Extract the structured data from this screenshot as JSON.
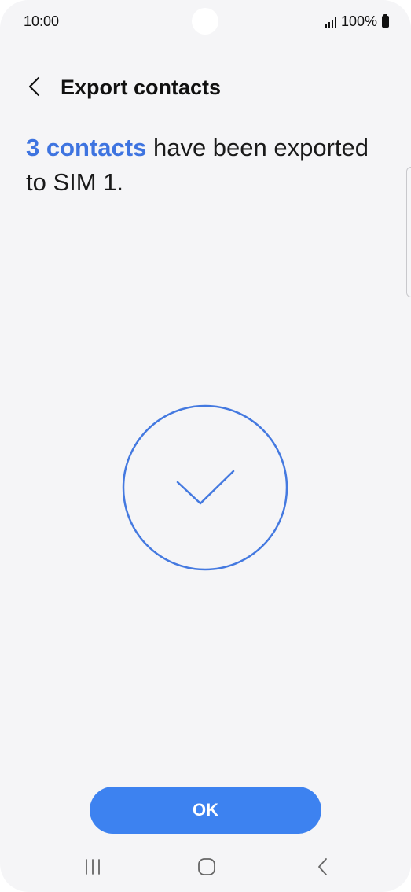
{
  "status_bar": {
    "time": "10:00",
    "battery_text": "100%",
    "icons": [
      "signal-icon",
      "battery-icon"
    ]
  },
  "header": {
    "title": "Export contacts",
    "back_icon": "chevron-left-icon"
  },
  "message": {
    "highlight": "3 contacts",
    "text": " have been exported to SIM 1."
  },
  "success_icon": "checkmark-circle-icon",
  "ok_button": {
    "label": "OK"
  },
  "nav_bar": {
    "icons": [
      "recents-icon",
      "home-icon",
      "back-icon"
    ]
  },
  "colors": {
    "accent": "#3e74e0",
    "button": "#3d82f0",
    "background": "#f5f5f7"
  }
}
